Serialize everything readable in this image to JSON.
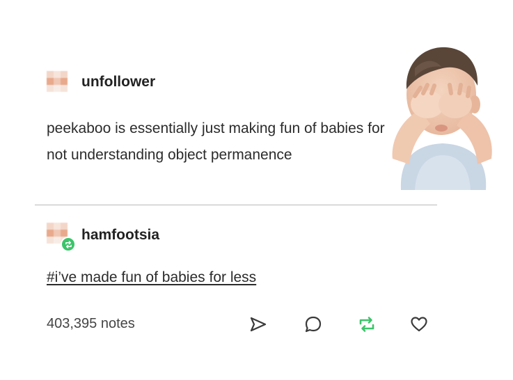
{
  "original_post": {
    "username": "unfollower",
    "text": "peekaboo is essentially just making fun of babies for not understanding object permanence"
  },
  "reblog": {
    "username": "hamfootsia",
    "tag": "#i’ve made fun of babies for less"
  },
  "footer": {
    "notes": "403,395 notes",
    "actions": [
      "share-icon",
      "reply-icon",
      "reblog-icon",
      "like-icon"
    ]
  },
  "colors": {
    "text": "#2b2b2b",
    "reblog_badge": "#3cc46a",
    "reblog_icon": "#3cc46a",
    "divider": "#b8b8b8"
  }
}
